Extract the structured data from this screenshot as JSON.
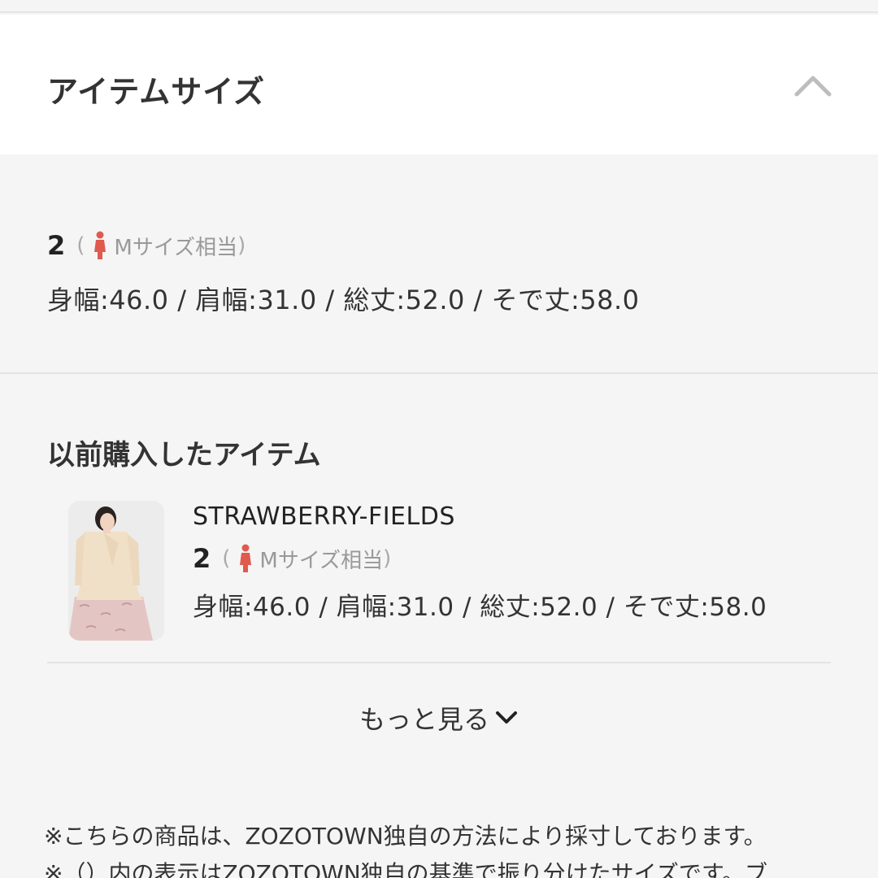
{
  "header": {
    "title": "アイテムサイズ",
    "collapse_icon": "chevron-up-icon"
  },
  "current_size": {
    "size": "2",
    "paren_open": "(",
    "equivalent": "Mサイズ相当",
    "paren_close": ")",
    "measurements": "身幅:46.0 / 肩幅:31.0 / 総丈:52.0 / そで丈:58.0",
    "person_icon_color": "#e05a4e"
  },
  "previous": {
    "title": "以前購入したアイテム",
    "items": [
      {
        "brand": "STRAWBERRY-FIELDS",
        "size": "2",
        "paren_open": "(",
        "equivalent": "Mサイズ相当",
        "paren_close": ")",
        "measurements": "身幅:46.0 / 肩幅:31.0 / 総丈:52.0 / そで丈:58.0"
      }
    ]
  },
  "more": {
    "label": "もっと見る",
    "icon": "chevron-down-icon"
  },
  "notes": [
    "※こちらの商品は、ZOZOTOWN独自の方法により採寸しております。",
    "※（）内の表示はZOZOTOWN独自の基準で振り分けたサイズです。ブ"
  ]
}
